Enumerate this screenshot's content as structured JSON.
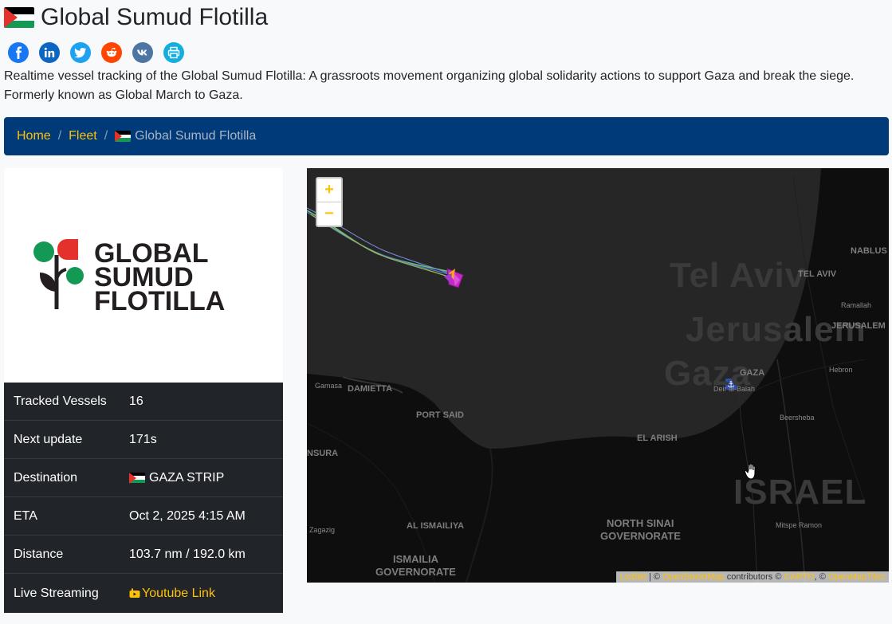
{
  "page": {
    "title": "Global Sumud Flotilla",
    "description": "Realtime vessel tracking of the Global Sumud Flotilla: A grassroots movement organizing global solidarity actions to support Gaza and break the siege. Formerly known as Global March to Gaza."
  },
  "share": [
    {
      "name": "facebook",
      "color": "#1877f2"
    },
    {
      "name": "linkedin",
      "color": "#0a66c2"
    },
    {
      "name": "twitter",
      "color": "#1da1f2"
    },
    {
      "name": "reddit",
      "color": "#ff4500"
    },
    {
      "name": "vk",
      "color": "#4c75a3"
    },
    {
      "name": "print",
      "color": "#12aee0"
    }
  ],
  "breadcrumb": {
    "home": "Home",
    "fleet": "Fleet",
    "current": "Global Sumud Flotilla"
  },
  "logo": {
    "line1": "GLOBAL",
    "line2": "SUMUD",
    "line3": "FLOTILLA"
  },
  "info": {
    "tracked_label": "Tracked Vessels",
    "tracked_value": "16",
    "next_label": "Next update",
    "next_value": "171s",
    "dest_label": "Destination",
    "dest_value": "GAZA STRIP",
    "eta_label": "ETA",
    "eta_value": "Oct 2, 2025 4:15 AM",
    "dist_label": "Distance",
    "dist_value": "103.7 nm / 192.0 km",
    "live_label": "Live Streaming",
    "live_value": "Youtube Link"
  },
  "map": {
    "zoom_in": "+",
    "zoom_out": "−",
    "labels": {
      "damietta": "DAMIETTA",
      "port_said": "PORT SAID",
      "el_arish": "EL ARISH",
      "al_ismailiya": "AL ISMAILIYA",
      "north_sinai": "NORTH SINAI",
      "governorate1": "GOVERNORATE",
      "ismailia": "ISMAILIA",
      "governorate2": "GOVERNORATE",
      "tel_aviv": "TEL AVIV",
      "jerusalem": "JERUSALEM",
      "nablus": "NABLUS",
      "ramallah": "Ramallah",
      "hebron": "Hebron",
      "gaza": "GAZA",
      "deir_al_balah": "Deir al-Balah",
      "beersheba": "Beersheba",
      "mitspe_ramon": "Mitspe Ramon",
      "zagazig": "Zagazig",
      "mansura": "NSURA",
      "gamasa": "Gamasa",
      "bg_tel_aviv": "Tel Aviv",
      "bg_jerusalem": "Jerusalem",
      "bg_gaza": "Gaza",
      "bg_israel": "ISRAEL"
    },
    "attribution": {
      "leaflet": "Leaflet",
      "sep1": " | © ",
      "osm": "OpenStreetMap",
      "contrib": " contributors © ",
      "carto": "CARTO",
      "sep2": ", © ",
      "openmaptiles": "OpenMapTiles"
    }
  }
}
